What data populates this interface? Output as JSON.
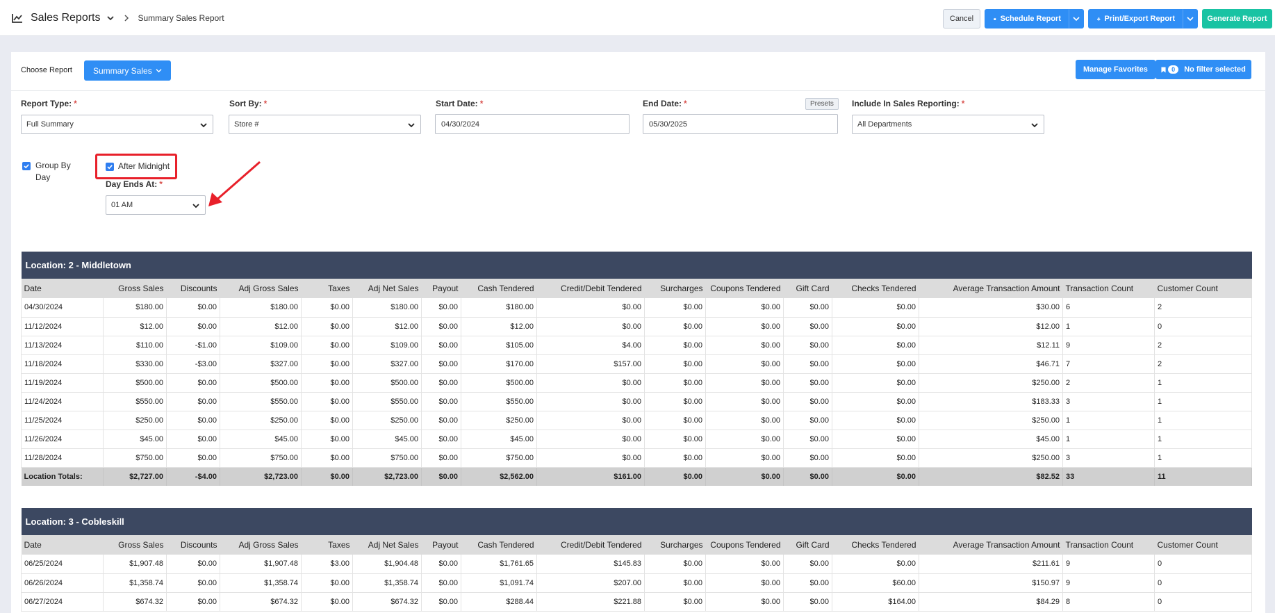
{
  "header": {
    "app_title": "Sales Reports",
    "breadcrumb": "Summary Sales Report",
    "cancel_label": "Cancel",
    "schedule_label": "Schedule Report",
    "print_label": "Print/Export Report",
    "generate_label": "Generate Report"
  },
  "choose": {
    "label": "Choose Report",
    "selected": "Summary Sales",
    "manage_label": "Manage Favorites",
    "filter_count": "0",
    "filter_label": "No filter selected"
  },
  "filters": {
    "report_type": {
      "label": "Report Type:",
      "value": "Full Summary"
    },
    "sort_by": {
      "label": "Sort By:",
      "value": "Store #"
    },
    "start_date": {
      "label": "Start Date:",
      "value": "04/30/2024"
    },
    "end_date": {
      "label": "End Date:",
      "value": "05/30/2025"
    },
    "presets_label": "Presets",
    "include": {
      "label": "Include In Sales Reporting:",
      "value": "All Departments"
    },
    "required_mark": "*"
  },
  "options": {
    "group_by_day_line1": "Group By",
    "group_by_day_line2": "Day",
    "group_by_day_checked": true,
    "after_midnight": "After Midnight",
    "after_midnight_checked": true,
    "day_ends_label": "Day Ends At:",
    "day_ends_value": "01 AM"
  },
  "columns": [
    "Date",
    "Gross Sales",
    "Discounts",
    "Adj Gross Sales",
    "Taxes",
    "Adj Net Sales",
    "Payout",
    "Cash Tendered",
    "Credit/Debit Tendered",
    "Surcharges",
    "Coupons Tendered",
    "Gift Card",
    "Checks Tendered",
    "Average Transaction Amount",
    "Transaction Count",
    "Customer Count"
  ],
  "locations": [
    {
      "title": "Location: 2 - Middletown",
      "rows": [
        [
          "04/30/2024",
          "$180.00",
          "$0.00",
          "$180.00",
          "$0.00",
          "$180.00",
          "$0.00",
          "$180.00",
          "$0.00",
          "$0.00",
          "$0.00",
          "$0.00",
          "$0.00",
          "$30.00",
          "6",
          "2"
        ],
        [
          "11/12/2024",
          "$12.00",
          "$0.00",
          "$12.00",
          "$0.00",
          "$12.00",
          "$0.00",
          "$12.00",
          "$0.00",
          "$0.00",
          "$0.00",
          "$0.00",
          "$0.00",
          "$12.00",
          "1",
          "0"
        ],
        [
          "11/13/2024",
          "$110.00",
          "-$1.00",
          "$109.00",
          "$0.00",
          "$109.00",
          "$0.00",
          "$105.00",
          "$4.00",
          "$0.00",
          "$0.00",
          "$0.00",
          "$0.00",
          "$12.11",
          "9",
          "2"
        ],
        [
          "11/18/2024",
          "$330.00",
          "-$3.00",
          "$327.00",
          "$0.00",
          "$327.00",
          "$0.00",
          "$170.00",
          "$157.00",
          "$0.00",
          "$0.00",
          "$0.00",
          "$0.00",
          "$46.71",
          "7",
          "2"
        ],
        [
          "11/19/2024",
          "$500.00",
          "$0.00",
          "$500.00",
          "$0.00",
          "$500.00",
          "$0.00",
          "$500.00",
          "$0.00",
          "$0.00",
          "$0.00",
          "$0.00",
          "$0.00",
          "$250.00",
          "2",
          "1"
        ],
        [
          "11/24/2024",
          "$550.00",
          "$0.00",
          "$550.00",
          "$0.00",
          "$550.00",
          "$0.00",
          "$550.00",
          "$0.00",
          "$0.00",
          "$0.00",
          "$0.00",
          "$0.00",
          "$183.33",
          "3",
          "1"
        ],
        [
          "11/25/2024",
          "$250.00",
          "$0.00",
          "$250.00",
          "$0.00",
          "$250.00",
          "$0.00",
          "$250.00",
          "$0.00",
          "$0.00",
          "$0.00",
          "$0.00",
          "$0.00",
          "$250.00",
          "1",
          "1"
        ],
        [
          "11/26/2024",
          "$45.00",
          "$0.00",
          "$45.00",
          "$0.00",
          "$45.00",
          "$0.00",
          "$45.00",
          "$0.00",
          "$0.00",
          "$0.00",
          "$0.00",
          "$0.00",
          "$45.00",
          "1",
          "1"
        ],
        [
          "11/28/2024",
          "$750.00",
          "$0.00",
          "$750.00",
          "$0.00",
          "$750.00",
          "$0.00",
          "$750.00",
          "$0.00",
          "$0.00",
          "$0.00",
          "$0.00",
          "$0.00",
          "$250.00",
          "3",
          "1"
        ]
      ],
      "totals": [
        "Location Totals:",
        "$2,727.00",
        "-$4.00",
        "$2,723.00",
        "$0.00",
        "$2,723.00",
        "$0.00",
        "$2,562.00",
        "$161.00",
        "$0.00",
        "$0.00",
        "$0.00",
        "$0.00",
        "$82.52",
        "33",
        "11"
      ]
    },
    {
      "title": "Location: 3 - Cobleskill",
      "rows": [
        [
          "06/25/2024",
          "$1,907.48",
          "$0.00",
          "$1,907.48",
          "$3.00",
          "$1,904.48",
          "$0.00",
          "$1,761.65",
          "$145.83",
          "$0.00",
          "$0.00",
          "$0.00",
          "$0.00",
          "$211.61",
          "9",
          "0"
        ],
        [
          "06/26/2024",
          "$1,358.74",
          "$0.00",
          "$1,358.74",
          "$0.00",
          "$1,358.74",
          "$0.00",
          "$1,091.74",
          "$207.00",
          "$0.00",
          "$0.00",
          "$0.00",
          "$60.00",
          "$150.97",
          "9",
          "0"
        ],
        [
          "06/27/2024",
          "$674.32",
          "$0.00",
          "$674.32",
          "$0.00",
          "$674.32",
          "$0.00",
          "$288.44",
          "$221.88",
          "$0.00",
          "$0.00",
          "$0.00",
          "$164.00",
          "$84.29",
          "8",
          "0"
        ]
      ]
    }
  ]
}
